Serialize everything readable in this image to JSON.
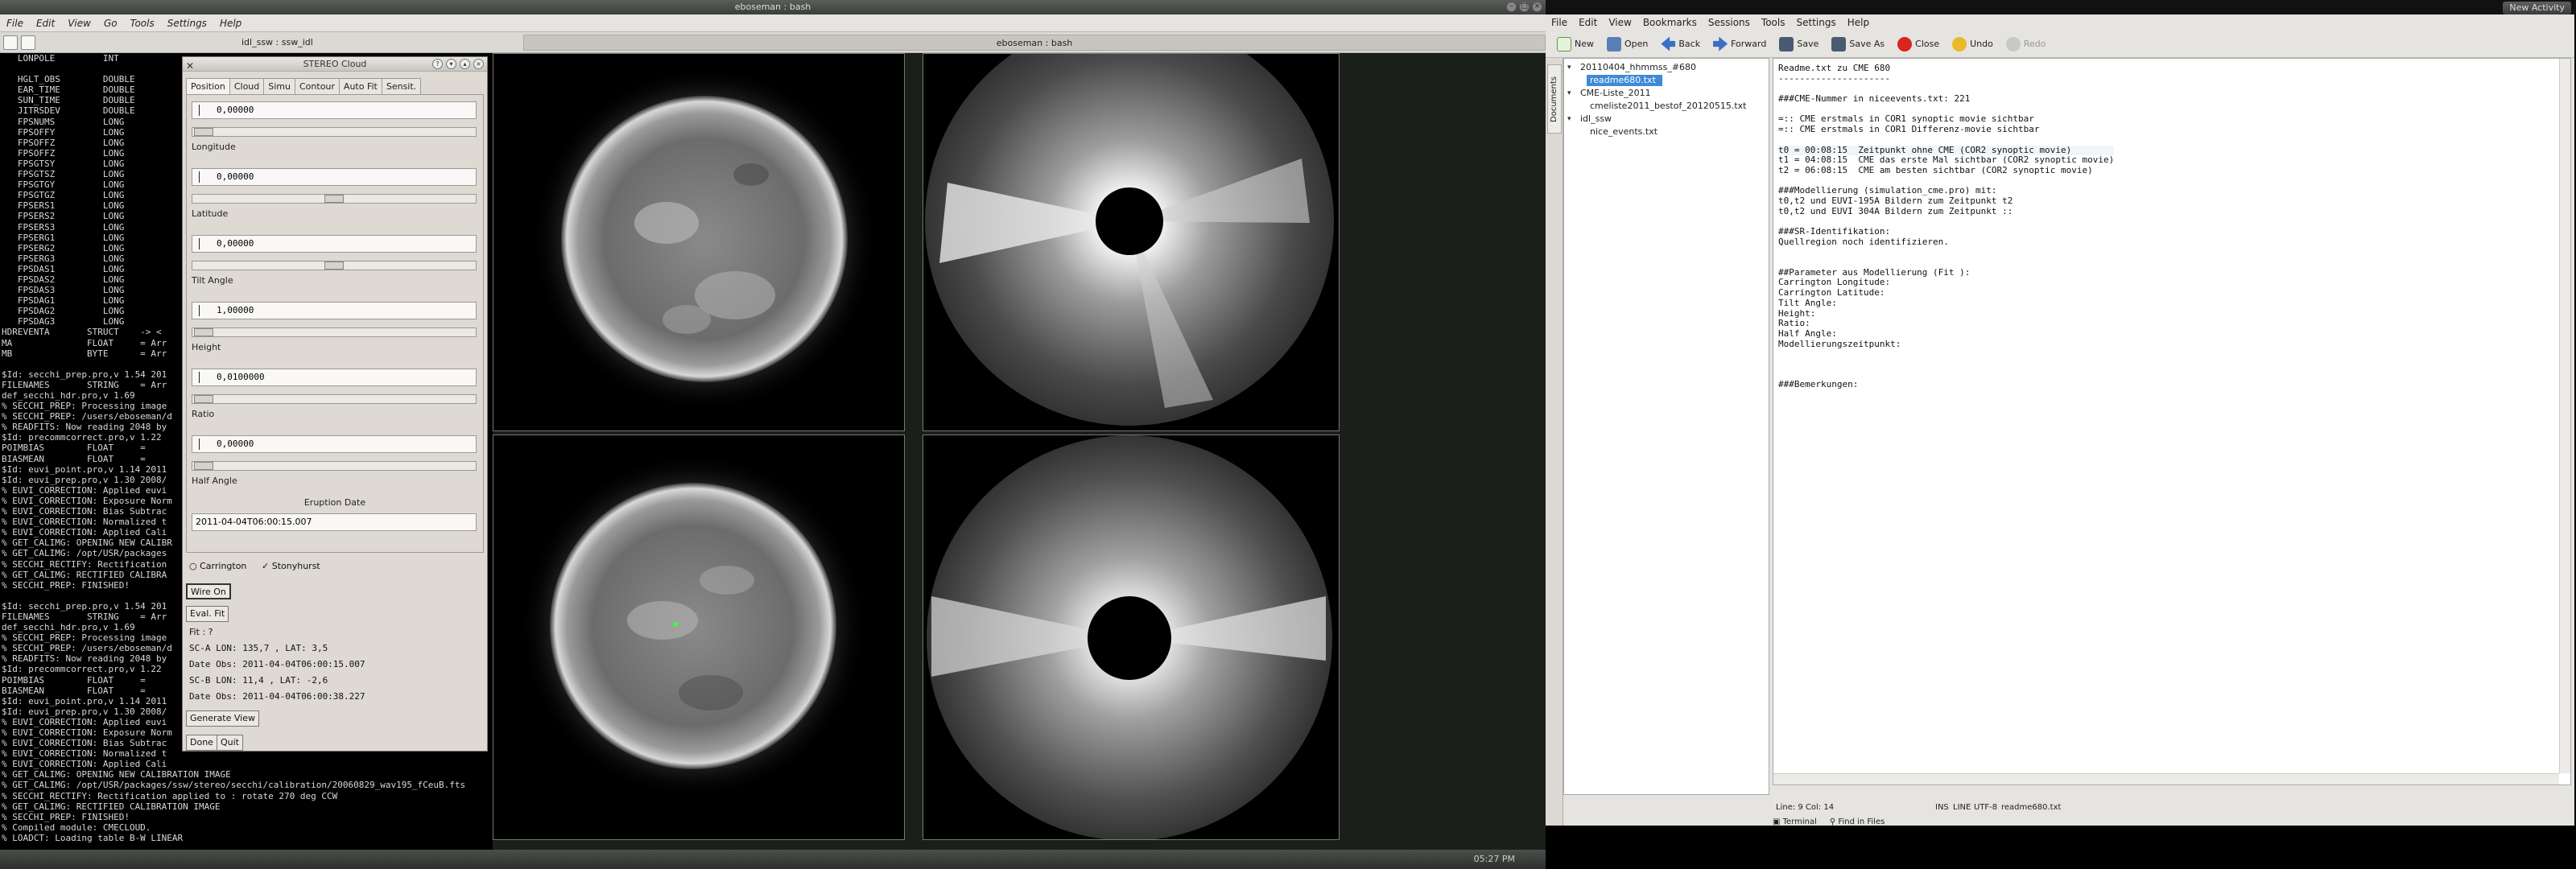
{
  "left_window": {
    "title": "eboseman : bash",
    "menu": [
      "File",
      "Edit",
      "View",
      "Go",
      "Tools",
      "Settings",
      "Help"
    ],
    "tab_idl": "idl_ssw : ssw_idl",
    "tab_bash": "eboseman : bash"
  },
  "terminal": {
    "lines": [
      "   LONPOLE         INT",
      "",
      "   HGLT_OBS        DOUBLE",
      "   EAR_TIME        DOUBLE",
      "   SUN_TIME        DOUBLE",
      "   JITRSDEV        DOUBLE",
      "   FPSNUMS         LONG",
      "   FPSOFFY         LONG",
      "   FPSOFFZ         LONG",
      "   FPSOFFZ         LONG",
      "   FPSGTSY         LONG",
      "   FPSGTSZ         LONG",
      "   FPSGTGY         LONG",
      "   FPSGTGZ         LONG",
      "   FPSERS1         LONG",
      "   FPSERS2         LONG",
      "   FPSERS3         LONG",
      "   FPSERG1         LONG",
      "   FPSERG2         LONG",
      "   FPSERG3         LONG",
      "   FPSDAS1         LONG",
      "   FPSDAS2         LONG",
      "   FPSDAS3         LONG",
      "   FPSDAG1         LONG",
      "   FPSDAG2         LONG",
      "   FPSDAG3         LONG",
      "HDREVENTA       STRUCT    -> <",
      "MA              FLOAT     = Arr",
      "MB              BYTE      = Arr",
      "",
      "$Id: secchi_prep.pro,v 1.54 201",
      "FILENAMES       STRING    = Arr",
      "def_secchi_hdr.pro,v 1.69",
      "% SECCHI_PREP: Processing image",
      "% SECCHI_PREP: /users/eboseman/d",
      "% READFITS: Now reading 2048 by",
      "$Id: precommcorrect.pro,v 1.22",
      "POIMBIAS        FLOAT     =",
      "BIASMEAN        FLOAT     =",
      "$Id: euvi_point.pro,v 1.14 2011",
      "$Id: euvi_prep.pro,v 1.30 2008/",
      "% EUVI_CORRECTION: Applied euvi",
      "% EUVI_CORRECTION: Exposure Norm",
      "% EUVI_CORRECTION: Bias Subtrac",
      "% EUVI_CORRECTION: Normalized t",
      "% EUVI_CORRECTION: Applied Cali",
      "% GET_CALIMG: OPENING NEW CALIBR",
      "% GET_CALIMG: /opt/USR/packages",
      "% SECCHI_RECTIFY: Rectification",
      "% GET_CALIMG: RECTIFIED CALIBRA",
      "% SECCHI_PREP: FINISHED!",
      "",
      "$Id: secchi_prep.pro,v 1.54 201",
      "FILENAMES       STRING    = Arr",
      "def_secchi_hdr.pro,v 1.69",
      "% SECCHI_PREP: Processing image",
      "% SECCHI_PREP: /users/eboseman/d",
      "% READFITS: Now reading 2048 by",
      "$Id: precommcorrect.pro,v 1.22",
      "POIMBIAS        FLOAT     =",
      "BIASMEAN        FLOAT     =",
      "$Id: euvi_point.pro,v 1.14 2011",
      "$Id: euvi_prep.pro,v 1.30 2008/",
      "% EUVI_CORRECTION: Applied euvi",
      "% EUVI_CORRECTION: Exposure Norm",
      "% EUVI_CORRECTION: Bias Subtrac",
      "% EUVI_CORRECTION: Normalized t",
      "% EUVI_CORRECTION: Applied Cali",
      "% GET_CALIMG: OPENING NEW CALIBRATION IMAGE",
      "% GET_CALIMG: /opt/USR/packages/ssw/stereo/secchi/calibration/20060829_wav195_fCeuB.fts",
      "% SECCHI_RECTIFY: Rectification applied to : rotate 270 deg CCW",
      "% GET_CALIMG: RECTIFIED CALIBRATION IMAGE",
      "% SECCHI_PREP: FINISHED!",
      "% Compiled module: CMECLOUD.",
      "% LOADCT: Loading table B-W LINEAR"
    ]
  },
  "cloud": {
    "title": "STEREO Cloud",
    "tabs": [
      "Position",
      "Cloud",
      "Simu",
      "Contour",
      "Auto Fit",
      "Sensit."
    ],
    "fields": [
      {
        "value": "0,00000",
        "label": "Longitude"
      },
      {
        "value": "0,00000",
        "label": "Latitude"
      },
      {
        "value": "0,00000",
        "label": "Tilt Angle"
      },
      {
        "value": "1,00000",
        "label": "Height"
      },
      {
        "value": "0,0100000",
        "label": "Ratio"
      },
      {
        "value": "0,00000",
        "label": "Half Angle"
      }
    ],
    "eruption_label": "Eruption Date",
    "eruption_value": "2011-04-04T06:00:15.007",
    "radio_carrington": "Carrington",
    "radio_stonyhurst": "Stonyhurst",
    "wire_on": "Wire On",
    "eval_fit": "Eval. Fit",
    "fit_text": "Fit : ?",
    "sc_a": "SC-A LON:  135,7 , LAT:   3,5",
    "date_obs_a": "Date Obs: 2011-04-04T06:00:15.007",
    "sc_b": "SC-B LON:  11,4 , LAT:  -2,6",
    "date_obs_b": "Date Obs: 2011-04-04T06:00:38.227",
    "generate_view": "Generate View",
    "done": "Done",
    "quit": "Quit"
  },
  "clock_left": "05:27 PM",
  "kate": {
    "new_activity": "New Activity",
    "menu": [
      "File",
      "Edit",
      "View",
      "Bookmarks",
      "Sessions",
      "Tools",
      "Settings",
      "Help"
    ],
    "toolbar": [
      "New",
      "Open",
      "Back",
      "Forward",
      "Save",
      "Save As",
      "Close",
      "Undo",
      "Redo"
    ],
    "sidebar_tab": "Documents",
    "tree": [
      {
        "text": "20110404_hhmmss_#680",
        "indent": 0,
        "arrow": true
      },
      {
        "text": "readme680.txt",
        "indent": 1,
        "selected": true
      },
      {
        "text": "CME-Liste_2011",
        "indent": 0,
        "arrow": true
      },
      {
        "text": "cmeliste2011_bestof_20120515.txt",
        "indent": 1
      },
      {
        "text": "idl_ssw",
        "indent": 0,
        "arrow": true
      },
      {
        "text": "nice_events.txt",
        "indent": 1
      }
    ],
    "editor_lines": [
      "Readme.txt zu CME 680",
      "---------------------",
      "",
      "###CME-Nummer in niceevents.txt: 221",
      "",
      "=:: CME erstmals in COR1 synoptic movie sichtbar",
      "=:: CME erstmals in COR1 Differenz-movie sichtbar",
      "",
      "t0 = 00:08:15  Zeitpunkt ohne CME (COR2 synoptic movie)",
      "t1 = 04:08:15  CME das erste Mal sichtbar (COR2 synoptic movie)",
      "t2 = 06:08:15  CME am besten sichtbar (COR2 synoptic movie)",
      "",
      "###Modellierung (simulation_cme.pro) mit:",
      "t0,t2 und EUVI-195A Bildern zum Zeitpunkt t2",
      "t0,t2 und EUVI 304A Bildern zum Zeitpunkt ::",
      "",
      "###SR-Identifikation:",
      "Quellregion noch identifizieren.",
      "",
      "",
      "##Parameter aus Modellierung (Fit ):",
      "Carrington Longitude:",
      "Carrington Latitude:",
      "Tilt Angle:",
      "Height:",
      "Ratio:",
      "Half Angle:",
      "Modellierungszeitpunkt:",
      "",
      "",
      "",
      "###Bemerkungen:"
    ],
    "status_line": "Line: 9 Col: 14",
    "status_ins": "INS",
    "status_line_mode": "LINE",
    "status_enc": "UTF-8",
    "status_file": "readme680.txt",
    "bottom_terminal": "Terminal",
    "bottom_find": "Find in Files"
  }
}
